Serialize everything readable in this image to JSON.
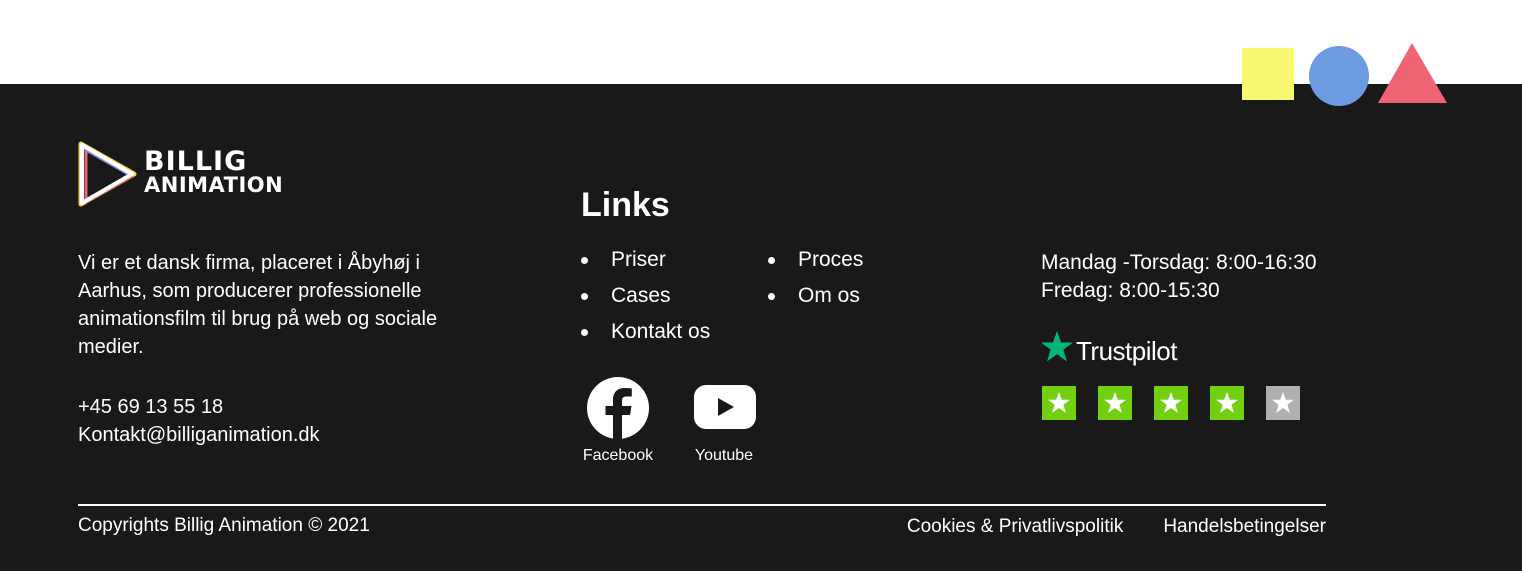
{
  "colors": {
    "footer_bg": "#191919",
    "shape_square": "#f8f871",
    "shape_circle": "#6d9be0",
    "shape_triangle": "#ef6475",
    "trustpilot_green": "#00b67a",
    "star_green": "#73cf11",
    "star_gray": "#b0b0b0"
  },
  "logo": {
    "line1": "BILLIG",
    "line2": "ANIMATION"
  },
  "about": {
    "text": "Vi er et dansk firma, placeret i Åbyhøj i Aarhus, som producerer professionelle animationsfilm til brug på web og sociale medier."
  },
  "contact": {
    "phone": "+45 69 13 55 18",
    "email": "Kontakt@billiganimation.dk"
  },
  "links": {
    "title": "Links",
    "col1": [
      "Priser",
      "Cases",
      "Kontakt os"
    ],
    "col2": [
      "Proces",
      "Om os"
    ]
  },
  "social": {
    "facebook_label": "Facebook",
    "youtube_label": "Youtube",
    "facebook_icon": "facebook-icon",
    "youtube_icon": "youtube-icon"
  },
  "hours": {
    "line1": "Mandag -Torsdag: 8:00-16:30",
    "line2": "Fredag: 8:00-15:30"
  },
  "trustpilot": {
    "name": "Trustpilot",
    "rating": 4,
    "max_rating": 5
  },
  "footer_bottom": {
    "copyright": "Copyrights Billig Animation © 2021",
    "cookies": "Cookies & Privatlivspolitik",
    "terms": "Handelsbetingelser"
  }
}
